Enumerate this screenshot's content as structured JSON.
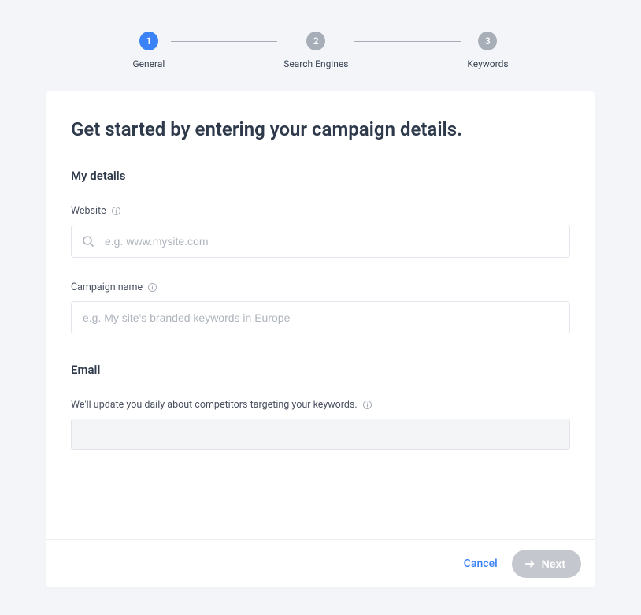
{
  "stepper": {
    "steps": [
      {
        "number": "1",
        "label": "General",
        "active": true
      },
      {
        "number": "2",
        "label": "Search Engines",
        "active": false
      },
      {
        "number": "3",
        "label": "Keywords",
        "active": false
      }
    ]
  },
  "page": {
    "title": "Get started by entering your campaign details."
  },
  "details": {
    "section_heading": "My details",
    "website": {
      "label": "Website",
      "placeholder": "e.g. www.mysite.com",
      "value": ""
    },
    "campaign": {
      "label": "Campaign name",
      "placeholder": "e.g. My site's branded keywords in Europe",
      "value": ""
    }
  },
  "email": {
    "section_heading": "Email",
    "description": "We'll update you daily about competitors targeting your keywords.",
    "value": ""
  },
  "footer": {
    "cancel_label": "Cancel",
    "next_label": "Next"
  }
}
